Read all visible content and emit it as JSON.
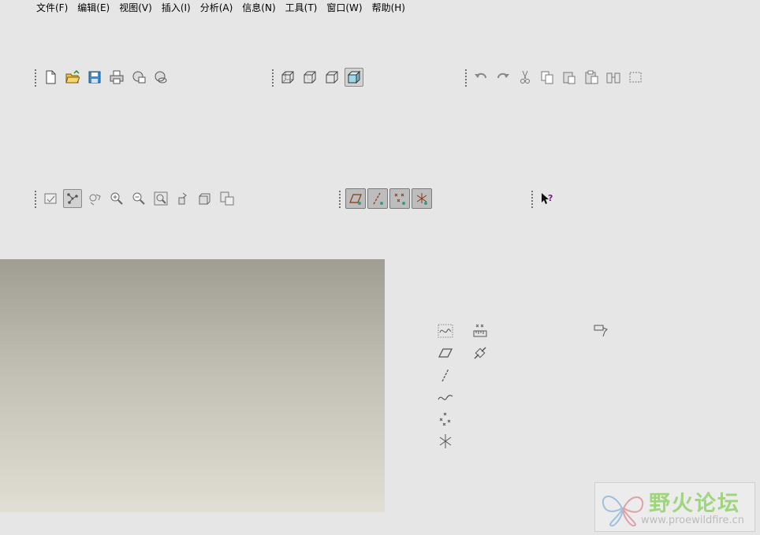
{
  "menu": [
    "文件(F)",
    "编辑(E)",
    "视图(V)",
    "插入(I)",
    "分析(A)",
    "信息(N)",
    "工具(T)",
    "窗口(W)",
    "帮助(H)"
  ],
  "toolbars": {
    "file": [
      "new-file-icon",
      "open-folder-icon",
      "save-icon",
      "print-icon",
      "send-mail-icon",
      "send-link-icon"
    ],
    "orient": [
      "no-hidden-icon",
      "hidden-line-icon",
      "wireframe-icon",
      "shading-icon"
    ],
    "edit": [
      "undo-icon",
      "redo-icon",
      "cut-icon",
      "copy-icon",
      "paste-icon",
      "paste-special-icon",
      "regenerate-icon",
      "select-box-icon"
    ],
    "view": [
      "repaint-icon",
      "spin-center-icon",
      "orient-mode-icon",
      "zoom-in-icon",
      "zoom-out-icon",
      "refit-icon",
      "reorient-icon",
      "saved-views-icon",
      "layers-icon"
    ],
    "datum_display": [
      "plane-display-icon",
      "axis-display-icon",
      "point-display-icon",
      "csys-display-icon"
    ],
    "help": [
      "context-help-icon"
    ]
  },
  "datum_tools": [
    "sketch-tool-icon",
    "plane-tool-icon",
    "axis-tool-icon",
    "curve-tool-icon",
    "point-tool-icon",
    "csys-tool-icon",
    "analysis-tool-icon",
    "link-tool-icon",
    "annotation-tool-icon"
  ],
  "watermark": {
    "title": "野火论坛",
    "url": "www.proewildfire.cn"
  },
  "colors": {
    "background": "#e6e6e6",
    "viewport_top": "#a09d92",
    "viewport_bottom": "#e1dfd4",
    "accent_purple": "#7a1a8c"
  }
}
